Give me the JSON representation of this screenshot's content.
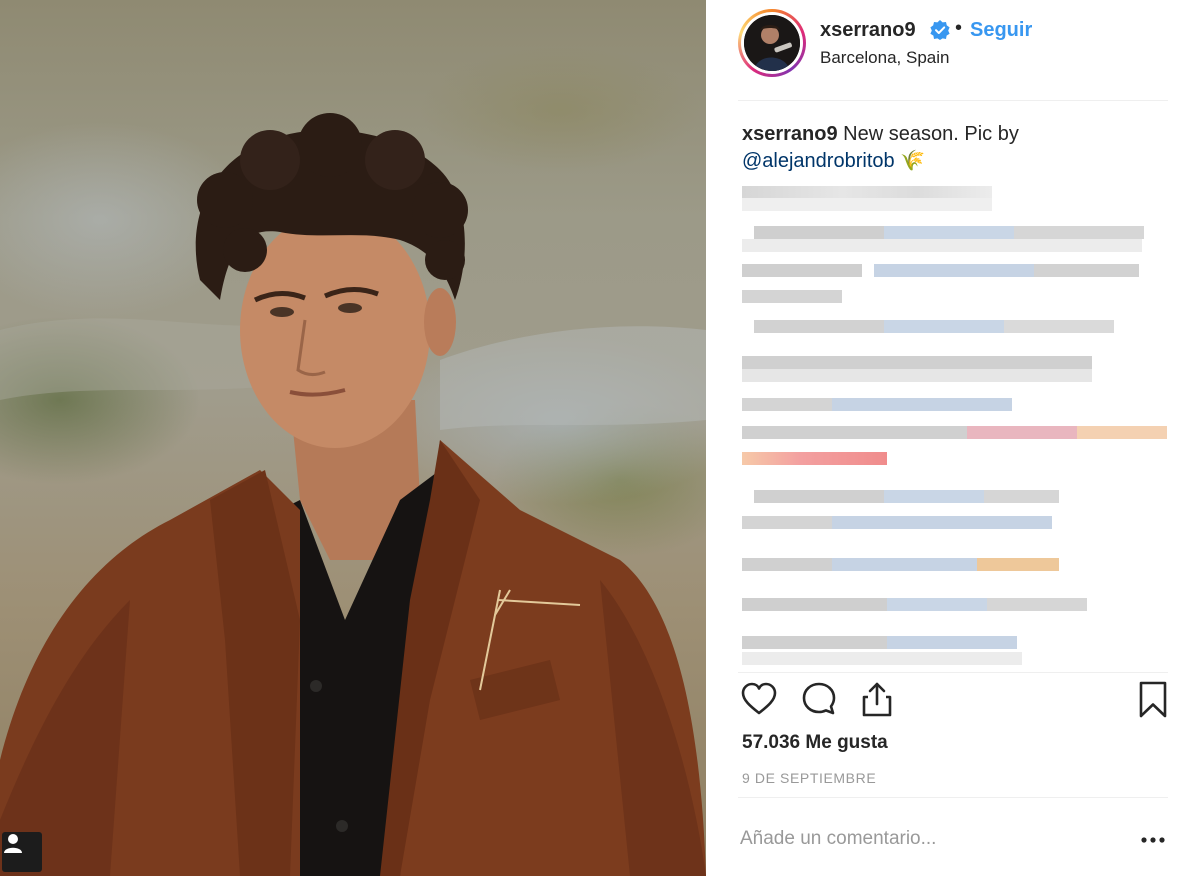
{
  "post": {
    "username": "xserrano9",
    "follow_label": "Seguir",
    "separator": "•",
    "location": "Barcelona, Spain",
    "caption_user": "xserrano9",
    "caption_text": " New season. Pic by",
    "caption_mention": "@alejandrobritob",
    "caption_emoji": "🌾",
    "likes": "57.036 Me gusta",
    "date": "9 DE SEPTIEMBRE",
    "comment_placeholder": "Añade un comentario...",
    "more_label": "•••"
  },
  "icons": {
    "verified": "verified-badge-icon",
    "like": "heart-icon",
    "comment": "comment-bubble-icon",
    "share": "share-icon",
    "save": "bookmark-icon",
    "more": "more-options-icon",
    "user": "user-icon"
  },
  "colors": {
    "link_blue": "#3897f0",
    "mention_blue": "#003569",
    "text": "#262626",
    "muted": "#999999",
    "divider": "#efefef",
    "jacket": "#7a3b1e"
  }
}
